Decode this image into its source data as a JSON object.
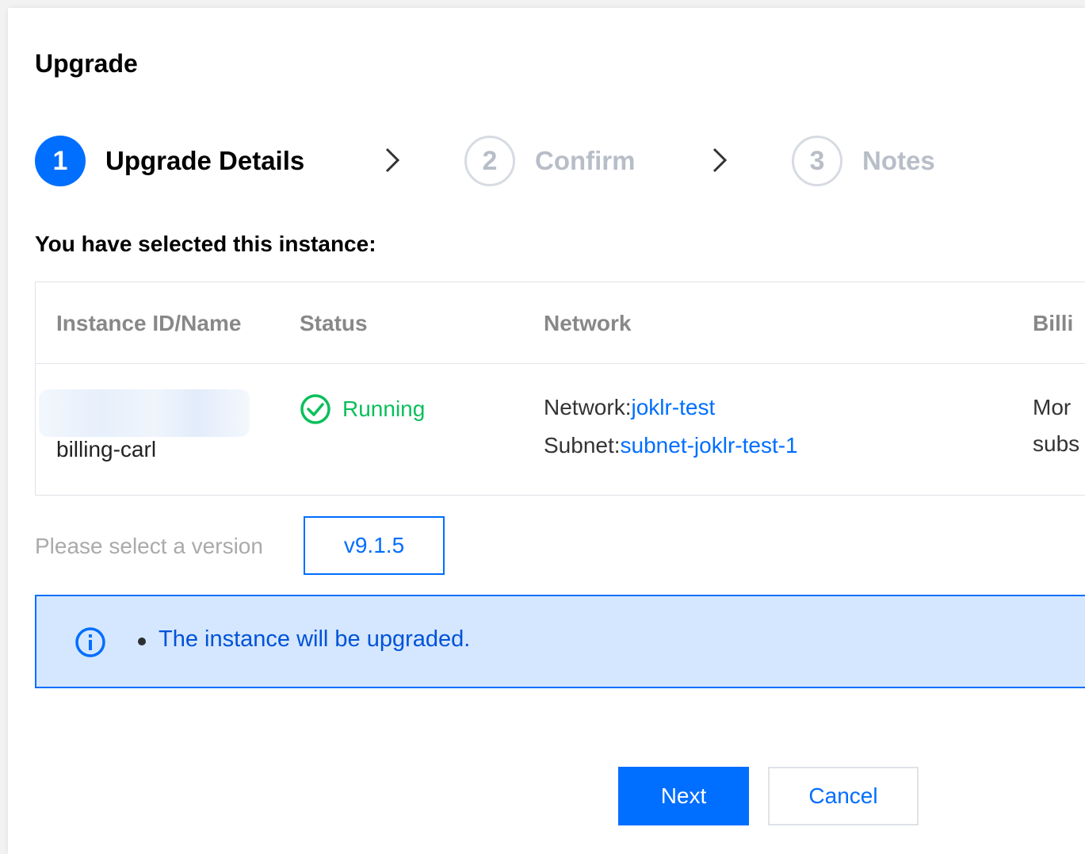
{
  "dialog": {
    "title": "Upgrade"
  },
  "steps": [
    {
      "number": "1",
      "label": "Upgrade Details",
      "active": true
    },
    {
      "number": "2",
      "label": "Confirm",
      "active": false
    },
    {
      "number": "3",
      "label": "Notes",
      "active": false
    }
  ],
  "section": {
    "label": "You have selected this instance:"
  },
  "table": {
    "columns": [
      "Instance ID/Name",
      "Status",
      "Network",
      "Billi"
    ],
    "row": {
      "instance_name": "billing-carl",
      "status": "Running",
      "network_label": "Network:",
      "network_value": "joklr-test",
      "subnet_label": "Subnet:",
      "subnet_value": "subnet-joklr-test-1",
      "billing_line1": "Mor",
      "billing_line2": "subs"
    }
  },
  "version": {
    "label": "Please select a version",
    "value": "v9.1.5"
  },
  "notice": {
    "text": "The instance will be upgraded."
  },
  "buttons": {
    "next": "Next",
    "cancel": "Cancel"
  },
  "colors": {
    "primary": "#006eff",
    "success": "#0abf5b",
    "notice_bg": "#d5e7ff"
  }
}
